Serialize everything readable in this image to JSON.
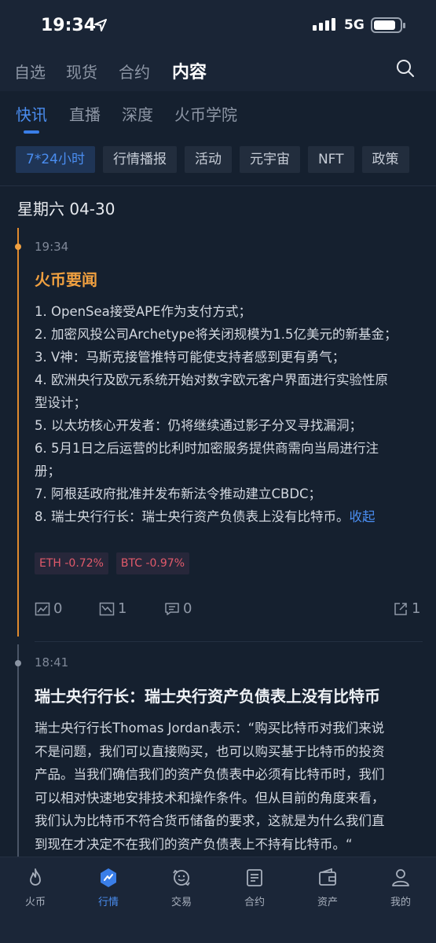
{
  "status_bar": {
    "time": "19:34",
    "network": "5G"
  },
  "top_nav": {
    "tabs": [
      "自选",
      "现货",
      "合约",
      "内容"
    ],
    "active": "内容"
  },
  "sub_tabs": {
    "tabs": [
      "快讯",
      "直播",
      "深度",
      "火币学院"
    ],
    "active": "快讯"
  },
  "chips": [
    "7*24小时",
    "行情播报",
    "活动",
    "元宇宙",
    "NFT",
    "政策"
  ],
  "date_header": "星期六 04-30",
  "news": [
    {
      "time": "19:34",
      "title": "火币要闻",
      "lines": [
        "1. OpenSea接受APE作为支付方式；",
        "2. 加密风投公司Archetype将关闭规模为1.5亿美元的新基金；",
        "3. V神：马斯克接管推特可能使支持者感到更有勇气；",
        "4. 欧洲央行及欧元系统开始对数字欧元客户界面进行实验性原",
        "型设计；",
        "5. 以太坊核心开发者：仍将继续通过影子分叉寻找漏洞；",
        "6. 5月1日之后运营的比利时加密服务提供商需向当局进行注",
        "册；",
        "7. 阿根廷政府批准并发布新法令推动建立CBDC；",
        "8. 瑞士央行行长：瑞士央行资产负债表上没有比特币。"
      ],
      "collapse_label": "收起",
      "tags": [
        "ETH -0.72%",
        "BTC -0.97%"
      ],
      "bullish_count": "0",
      "bearish_count": "1",
      "comment_count": "0",
      "share_count": "1"
    },
    {
      "time": "18:41",
      "title": "瑞士央行行长：瑞士央行资产负债表上没有比特币",
      "lines": [
        "瑞士央行行长Thomas Jordan表示：“购买比特币对我们来说",
        "不是问题，我们可以直接购买，也可以购买基于比特币的投资",
        "产品。当我们确信我们的资产负债表中必须有比特币时，我们",
        "可以相对快速地安排技术和操作条件。但从目前的角度来看，",
        "我们认为比特币不符合货币储备的要求，这就是为什么我们直",
        "到现在才决定不在我们的资产负债表上不持有比特币。“"
      ]
    }
  ],
  "bottom_nav": [
    {
      "label": "火币",
      "icon": "flame-icon"
    },
    {
      "label": "行情",
      "icon": "market-icon"
    },
    {
      "label": "交易",
      "icon": "trade-icon"
    },
    {
      "label": "合约",
      "icon": "contract-icon"
    },
    {
      "label": "资产",
      "icon": "wallet-icon"
    },
    {
      "label": "我的",
      "icon": "profile-icon"
    }
  ],
  "bottom_nav_active": "行情",
  "colors": {
    "accent": "#4a8df0",
    "highlight": "#f0a040",
    "down": "#e25a6b",
    "background": "#15202f"
  }
}
